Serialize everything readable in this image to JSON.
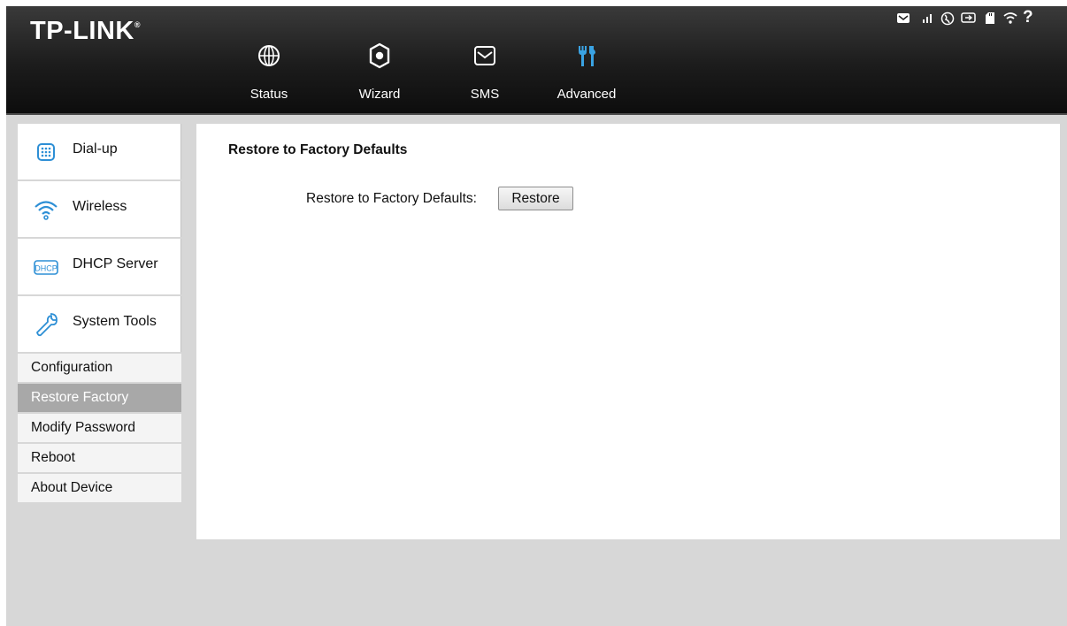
{
  "brand": {
    "logo_text": "TP-LINK",
    "registered_mark": "®"
  },
  "nav": [
    {
      "label": "Status",
      "icon": "globe-icon"
    },
    {
      "label": "Wizard",
      "icon": "gear-icon"
    },
    {
      "label": "SMS",
      "icon": "envelope-icon"
    },
    {
      "label": "Advanced",
      "icon": "tools-icon",
      "active": true
    }
  ],
  "status_bar": {
    "icons": [
      "message-icon",
      "signal-icon",
      "internet-globe-icon",
      "battery-icon",
      "sd-card-icon",
      "wifi-icon",
      "help-icon"
    ],
    "help_text": "?"
  },
  "sidebar": {
    "items": [
      {
        "label": "Dial-up",
        "icon": "dialpad-icon"
      },
      {
        "label": "Wireless",
        "icon": "wifi-icon"
      },
      {
        "label": "DHCP Server",
        "icon": "dhcp-icon",
        "icon_text": "DHCP"
      },
      {
        "label": "System Tools",
        "icon": "wrench-icon"
      }
    ],
    "sub_items": [
      {
        "label": "Configuration"
      },
      {
        "label": "Restore Factory",
        "active": true
      },
      {
        "label": "Modify Password"
      },
      {
        "label": "Reboot"
      },
      {
        "label": "About Device"
      }
    ]
  },
  "main": {
    "title": "Restore to Factory Defaults",
    "restore_label": "Restore to Factory Defaults:",
    "restore_button": "Restore"
  },
  "colors": {
    "header_bg": "#1c1c1c",
    "nav_active_icon": "#3aa3e3",
    "sidebar_icon": "#2d8fd5",
    "active_sub_bg": "#a8a8a8",
    "page_bg": "#d7d7d7"
  }
}
